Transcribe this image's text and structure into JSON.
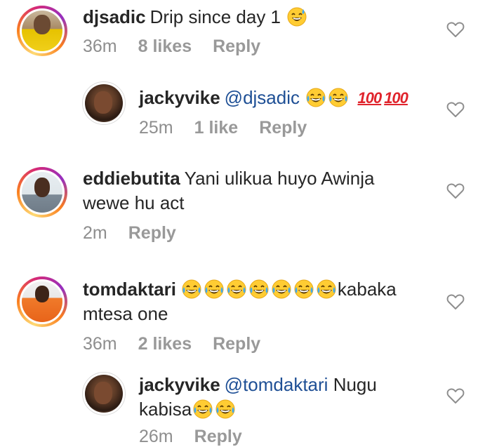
{
  "comments": [
    {
      "username": "djsadic",
      "text": "Drip since day 1",
      "emoji": [
        "grinning-sweat"
      ],
      "time": "36m",
      "likes": "8 likes",
      "reply": "Reply"
    },
    {
      "username": "jackyvike",
      "mention": "@djsadic",
      "emoji": [
        "tears-of-joy",
        "tears-of-joy",
        "hundred-points",
        "hundred-points"
      ],
      "hundred_glyph": "100",
      "time": "25m",
      "likes": "1 like",
      "reply": "Reply"
    },
    {
      "username": "eddiebutita",
      "text": "Yani ulikua huyo Awinja wewe hu act",
      "time": "2m",
      "reply": "Reply"
    },
    {
      "username": "tomdaktari",
      "emoji": [
        "tears-of-joy",
        "tears-of-joy",
        "tears-of-joy",
        "tears-of-joy",
        "tears-of-joy",
        "tears-of-joy",
        "tears-of-joy"
      ],
      "text": "kabaka mtesa one",
      "time": "36m",
      "likes": "2 likes",
      "reply": "Reply"
    },
    {
      "username": "jackyvike",
      "mention": "@tomdaktari",
      "text": "Nugu kabisa",
      "emoji": [
        "tears-of-joy",
        "tears-of-joy"
      ],
      "time": "26m",
      "reply": "Reply"
    }
  ],
  "colors": {
    "mention": "#1e4f95",
    "meta": "#8e8e8e",
    "text": "#262626"
  }
}
